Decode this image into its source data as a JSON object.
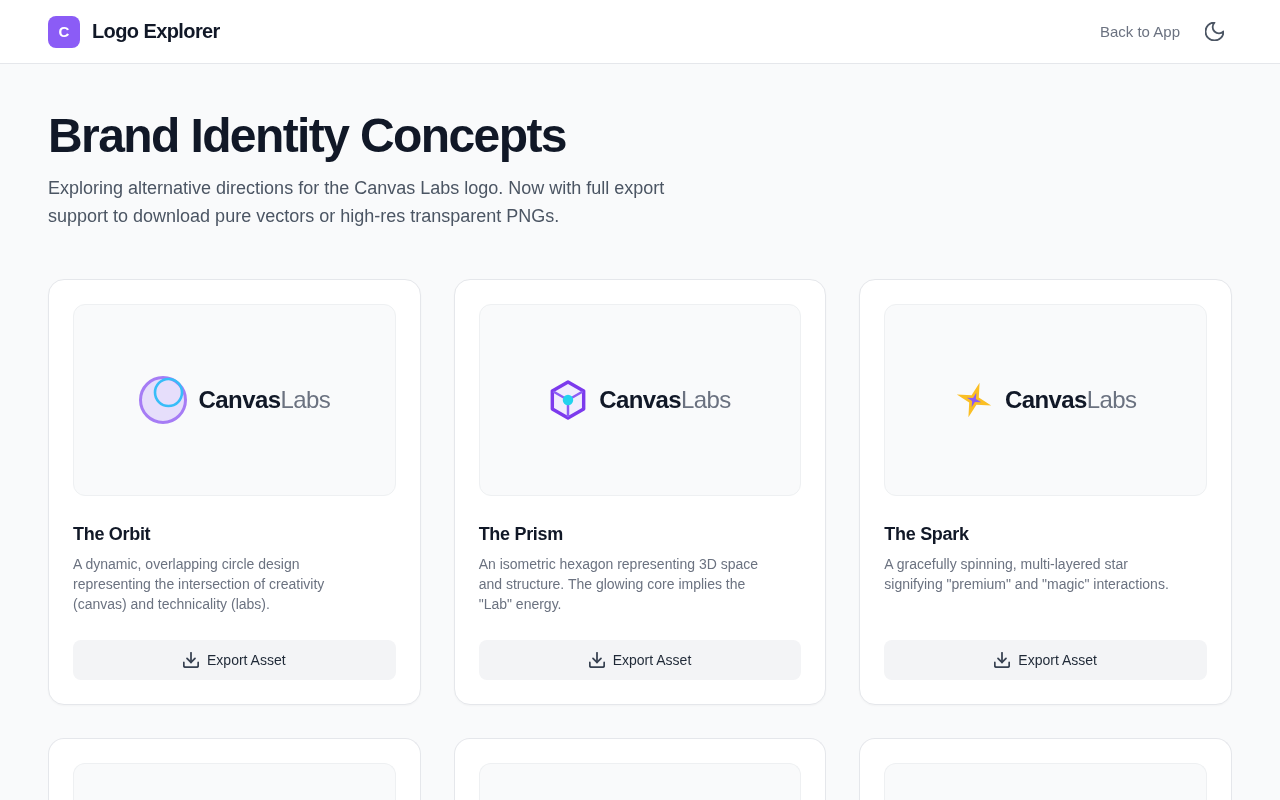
{
  "header": {
    "logo_letter": "C",
    "title": "Logo Explorer",
    "back_link": "Back to App"
  },
  "intro": {
    "title": "Brand Identity Concepts",
    "subtitle": "Exploring alternative directions for the Canvas Labs logo. Now with full export support to download pure vectors or high-res transparent PNGs."
  },
  "concepts": [
    {
      "kind": "concept",
      "logo": {
        "kind": "orbit",
        "wordmark_strong": "Canvas",
        "wordmark_light": "Labs"
      },
      "name": "The Orbit",
      "description": "A dynamic, overlapping circle design representing the intersection of creativity (canvas) and technicality (labs).",
      "button": "Export Asset"
    },
    {
      "kind": "concept",
      "logo": {
        "kind": "prism",
        "wordmark_strong": "Canvas",
        "wordmark_light": "Labs"
      },
      "name": "The Prism",
      "description": "An isometric hexagon representing 3D space and structure. The glowing core implies the \"Lab\" energy.",
      "button": "Export Asset"
    },
    {
      "kind": "concept",
      "logo": {
        "kind": "spark",
        "wordmark_strong": "Canvas",
        "wordmark_light": "Labs"
      },
      "name": "The Spark",
      "description": "A gracefully spinning, multi-layered star signifying \"premium\" and \"magic\" interactions.",
      "button": "Export Asset"
    },
    {
      "kind": "partial"
    },
    {
      "kind": "partial"
    },
    {
      "kind": "partial"
    }
  ]
}
